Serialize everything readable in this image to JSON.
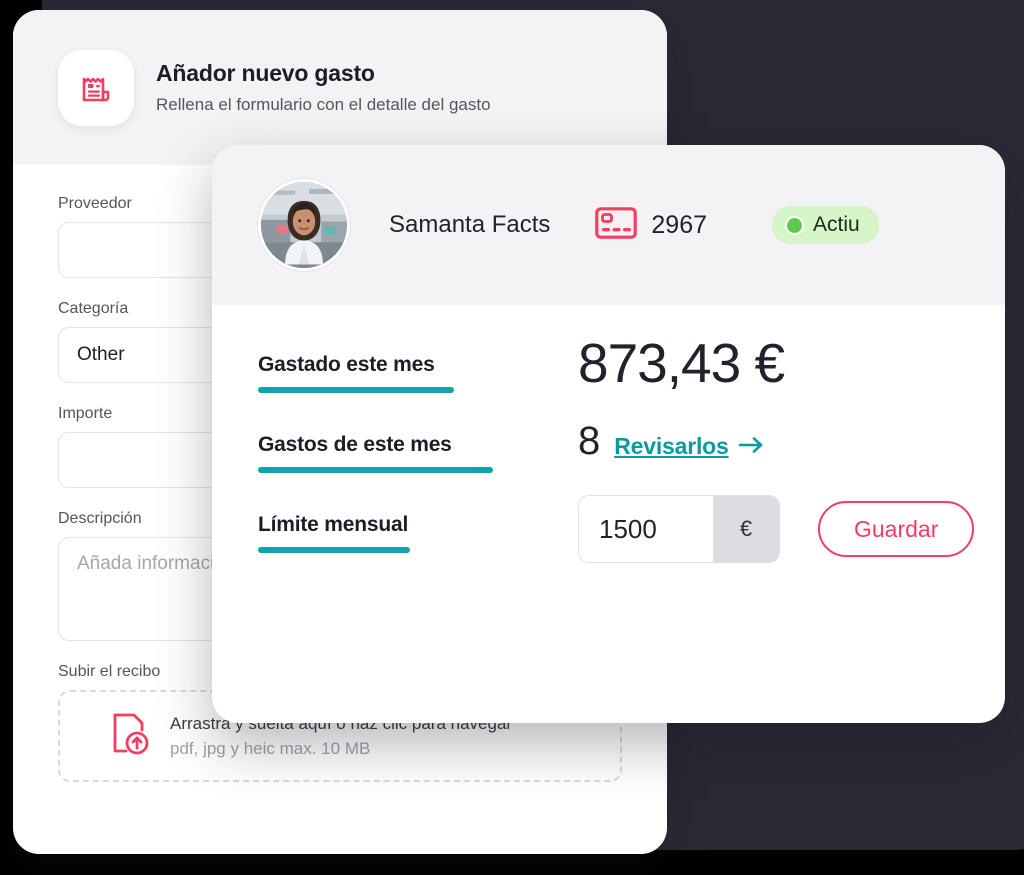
{
  "theme": {
    "accent_red": "#f43d5f",
    "accent_teal": "#11a5ab",
    "link_teal": "#0d9a9f",
    "status_green_bg": "#d6f5c9",
    "status_green_dot": "#5fc84e",
    "backdrop_navy": "#2a2a35",
    "panel_grey": "#f3f3f5"
  },
  "form_card": {
    "icon": "receipt-icon",
    "title": "Añador nuevo gasto",
    "subtitle": "Rellena el formulario con el detalle del gasto",
    "fields": [
      {
        "label": "Proveedor",
        "value": "",
        "placeholder": "",
        "type": "text"
      },
      {
        "label": "Categoría",
        "value": "Other",
        "placeholder": "",
        "type": "select"
      },
      {
        "label": "Importe",
        "value": "",
        "placeholder": "",
        "type": "text"
      },
      {
        "label": "Descripción",
        "value": "",
        "placeholder": "Añada información",
        "type": "textarea"
      }
    ],
    "upload": {
      "label": "Subir el recibo",
      "icon": "file-upload-icon",
      "primary_text": "Arrastra y suelta aquí o haz clic para navegar",
      "hint_text": "pdf, jpg y heic max. 10 MB"
    }
  },
  "detail_card": {
    "header": {
      "avatar": "user-avatar-photo",
      "name": "Samanta Facts",
      "card_icon": "credit-card-icon",
      "card_number": "2967",
      "status": {
        "dot": "status-dot-green",
        "label": "Actiu"
      }
    },
    "stats": [
      {
        "label": "Gastado este mes",
        "value": "873,43 €"
      },
      {
        "label": "Gastos de este mes",
        "count": "8",
        "link_label": "Revisarlos",
        "link_icon": "arrow-right-icon"
      },
      {
        "label": "Límite mensual",
        "input_value": "1500",
        "input_unit": "€",
        "save_label": "Guardar"
      }
    ]
  }
}
